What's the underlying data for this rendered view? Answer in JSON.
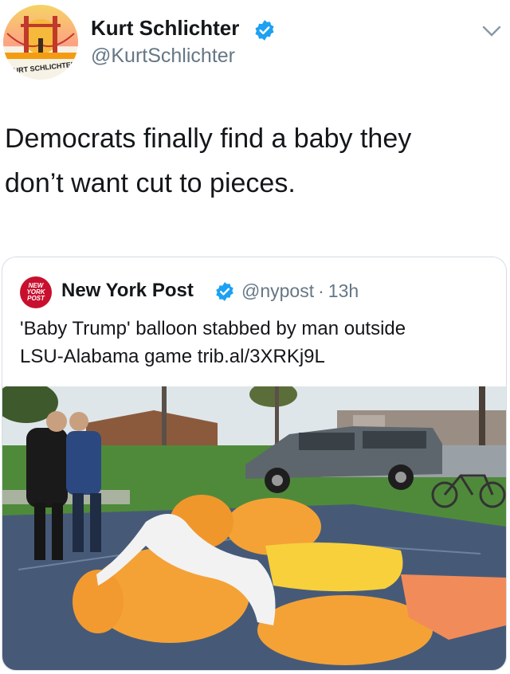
{
  "tweet": {
    "author": {
      "display_name": "Kurt Schlichter",
      "handle": "@KurtSchlichter",
      "avatar_label": "KURT SCHLICHTER",
      "verified": true
    },
    "text_line1": "Democrats finally find a baby they",
    "text_line2": "don’t want cut to pieces.",
    "menu_icon": "chevron-down-icon"
  },
  "quoted": {
    "author": {
      "display_name": "New York Post",
      "handle": "@nypost",
      "logo_text": "NEW YORK POST",
      "verified": true
    },
    "separator": "·",
    "time": "13h",
    "text_line1": "'Baby Trump' balloon stabbed by man outside",
    "text_line2": "LSU-Alabama game trib.al/3XRKj9L",
    "photo_description_icon": "photo-icon"
  },
  "colors": {
    "verified_blue": "#1da1f2",
    "secondary_text": "#657786",
    "nypost_red": "#c8102e",
    "balloon_orange": "#f4a236",
    "card_border": "#d7dde2"
  }
}
